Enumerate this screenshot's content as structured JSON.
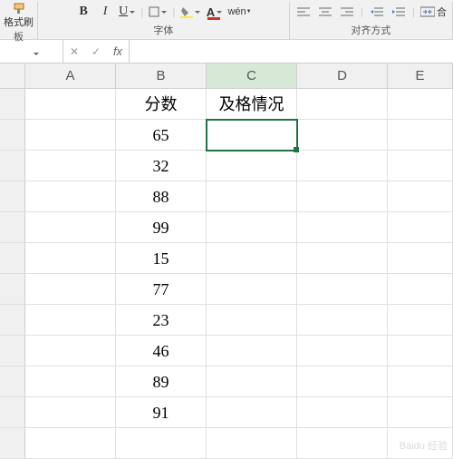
{
  "ribbon": {
    "format_painter_label": "格式刷",
    "clipboard_group_label": "板",
    "font_group_label": "字体",
    "alignment_group_label": "对齐方式",
    "bold_label": "B",
    "italic_label": "I",
    "underline_label": "U",
    "merge_label": "合"
  },
  "formula_bar": {
    "name_box_value": "",
    "cancel_icon": "✕",
    "confirm_icon": "✓",
    "fx_label": "fx",
    "formula_value": ""
  },
  "columns": [
    "A",
    "B",
    "C",
    "D",
    "E"
  ],
  "selected_column_index": 2,
  "selected_cell": {
    "col": 2,
    "row": 1
  },
  "cells": {
    "B": [
      "分数",
      "65",
      "32",
      "88",
      "99",
      "15",
      "77",
      "23",
      "46",
      "89",
      "91"
    ],
    "C": [
      "及格情况",
      "",
      "",
      "",
      "",
      "",
      "",
      "",
      "",
      "",
      ""
    ]
  },
  "row_count": 12,
  "watermark": "Baidu 经验"
}
